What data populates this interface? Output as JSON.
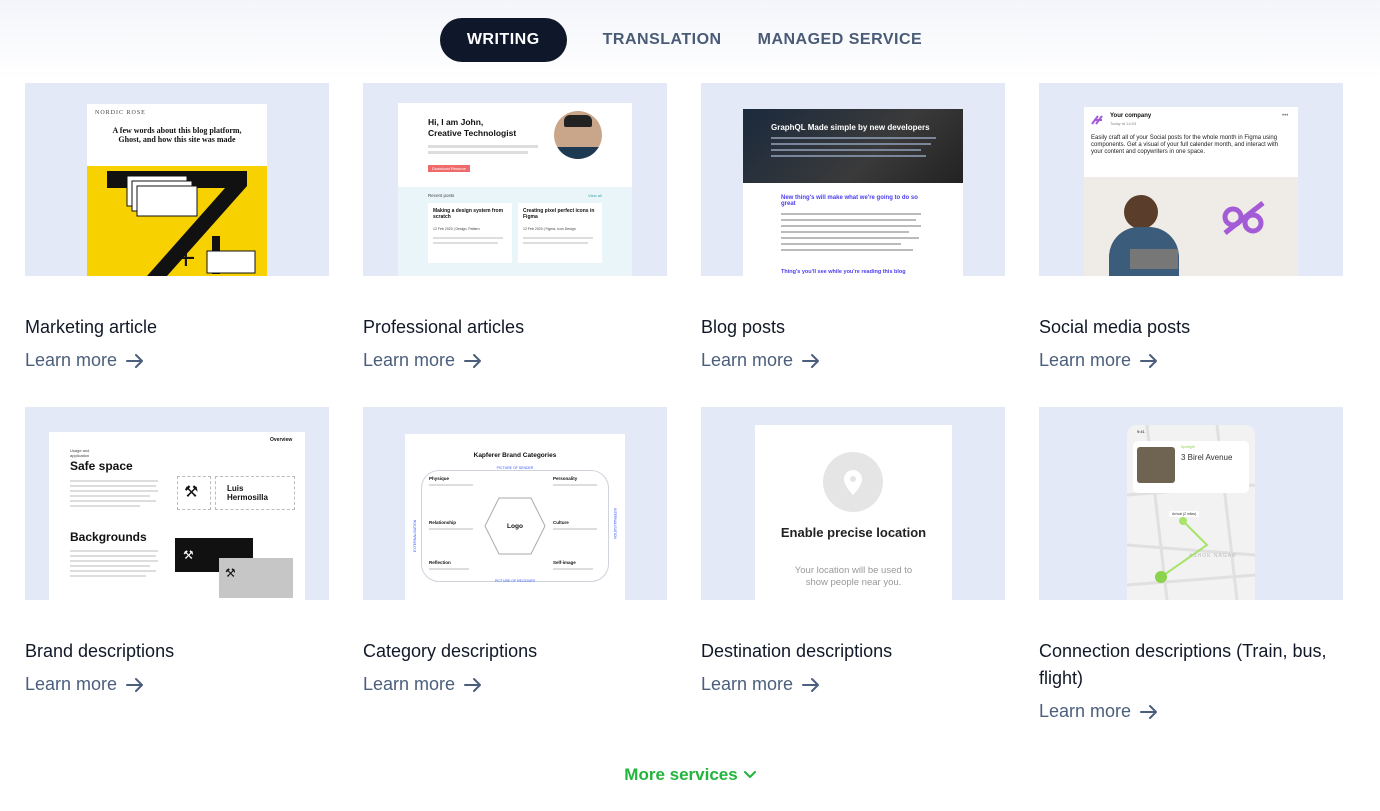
{
  "tabs": [
    {
      "label": "WRITING",
      "active": true
    },
    {
      "label": "TRANSLATION",
      "active": false
    },
    {
      "label": "MANAGED SERVICE",
      "active": false
    }
  ],
  "cards": [
    {
      "title": "Marketing article",
      "link": "Learn more",
      "thumb": {
        "brand": "NORDIC ROSE",
        "headline": "A few words about this blog platform, Ghost, and how this site was made"
      }
    },
    {
      "title": "Professional articles",
      "link": "Learn more",
      "thumb": {
        "greeting": "Hi, I am John,",
        "role": "Creative Technologist",
        "recent": "Recent posts",
        "view_all": "View all",
        "post1": "Making a design system from scratch",
        "post2": "Creating pixel perfect icons in Figma",
        "post1_meta": "12 Feb 2020  |  Design, Pattern",
        "post2_meta": "12 Feb 2020  |  Figma, Icon Design",
        "cta": "Download Resume"
      }
    },
    {
      "title": "Blog posts",
      "link": "Learn more",
      "thumb": {
        "banner": "GraphQL Made simple by new developers",
        "sub": "New thing's will make what we're going to do so great",
        "footer": "Thing's you'll see while you're reading this blog"
      }
    },
    {
      "title": "Social media posts",
      "link": "Learn more",
      "thumb": {
        "company": "Your company",
        "time": "Today at 14:03",
        "body": "Easily craft all of your Social posts for the whole month in Figma using components. Get a visual of your full calender month, and interact with your content and copywriters in one space."
      }
    },
    {
      "title": "Brand descriptions",
      "link": "Learn more",
      "thumb": {
        "overview": "Overview",
        "usage": "Usage and application",
        "safe": "Safe space",
        "bg": "Backgrounds",
        "name1": "Luis",
        "name2": "Hermosilla"
      }
    },
    {
      "title": "Category descriptions",
      "link": "Learn more",
      "thumb": {
        "title": "Kapferer Brand Categories",
        "center": "Logo",
        "top": "PICTURE OF SENDER",
        "bottom": "PICTURE OF RECEIVER",
        "left": "EXTERNALISATION",
        "right": "INTERNALISATION",
        "physique": "Physique",
        "personality": "Personality",
        "relationship": "Relationship",
        "culture": "Culture",
        "reflection": "Reflection",
        "self_image": "Self-image"
      }
    },
    {
      "title": "Destination descriptions",
      "link": "Learn more",
      "thumb": {
        "heading": "Enable precise location",
        "body": "Your location will be used to show people near you."
      }
    },
    {
      "title": "Connection descriptions (Train, bus, flight)",
      "link": "Learn more",
      "thumb": {
        "time": "9:41",
        "label": "Spotlight",
        "place": "3 Birel Avenue",
        "arrival": "Arrival (2 miles)",
        "area": "ASHOK NAGAR"
      }
    }
  ],
  "more_services": "More services",
  "colors": {
    "accent_green": "#22b53c",
    "tab_active_bg": "#0f172a",
    "thumb_bg": "#e4e9f8",
    "link": "#4b5e7b"
  }
}
